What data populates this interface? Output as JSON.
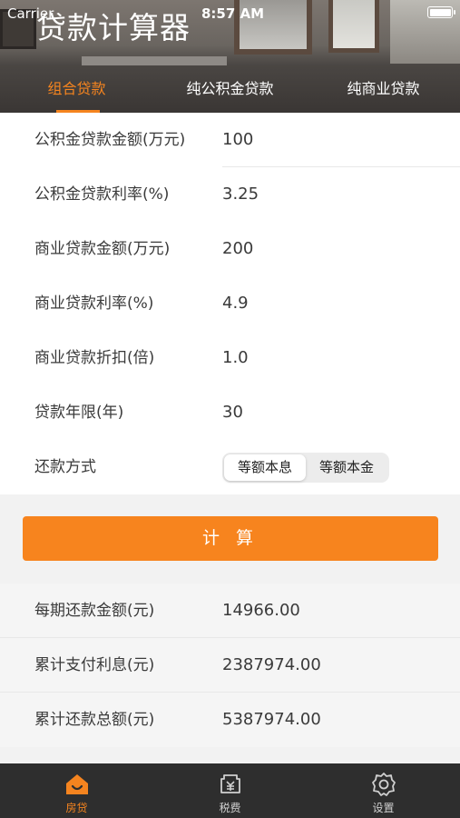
{
  "status_bar": {
    "carrier": "Carrier",
    "time": "8:57 AM"
  },
  "app": {
    "title": "贷款计算器"
  },
  "tabs": [
    {
      "label": "组合贷款",
      "active": true
    },
    {
      "label": "纯公积金贷款",
      "active": false
    },
    {
      "label": "纯商业贷款",
      "active": false
    }
  ],
  "form": {
    "rows": [
      {
        "label": "公积金贷款金额(万元)",
        "value": "100"
      },
      {
        "label": "公积金贷款利率(%)",
        "value": "3.25"
      },
      {
        "label": "商业贷款金额(万元)",
        "value": "200"
      },
      {
        "label": "商业贷款利率(%)",
        "value": "4.9"
      },
      {
        "label": "商业贷款折扣(倍)",
        "value": "1.0"
      },
      {
        "label": "贷款年限(年)",
        "value": "30"
      }
    ],
    "repayment": {
      "label": "还款方式",
      "options": [
        "等额本息",
        "等额本金"
      ],
      "selected": "等额本息"
    }
  },
  "calculate_button": "计 算",
  "results": [
    {
      "label": "每期还款金额(元)",
      "value": "14966.00"
    },
    {
      "label": "累计支付利息(元)",
      "value": "2387974.00"
    },
    {
      "label": "累计还款总额(元)",
      "value": "5387974.00"
    }
  ],
  "tabbar": [
    {
      "label": "房贷",
      "icon": "house-icon",
      "active": true
    },
    {
      "label": "税费",
      "icon": "tax-icon",
      "active": false
    },
    {
      "label": "设置",
      "icon": "gear-icon",
      "active": false
    }
  ],
  "colors": {
    "accent": "#f5841f",
    "tabbar_bg": "#2e2e2e",
    "header_bg": "#3a3634"
  }
}
